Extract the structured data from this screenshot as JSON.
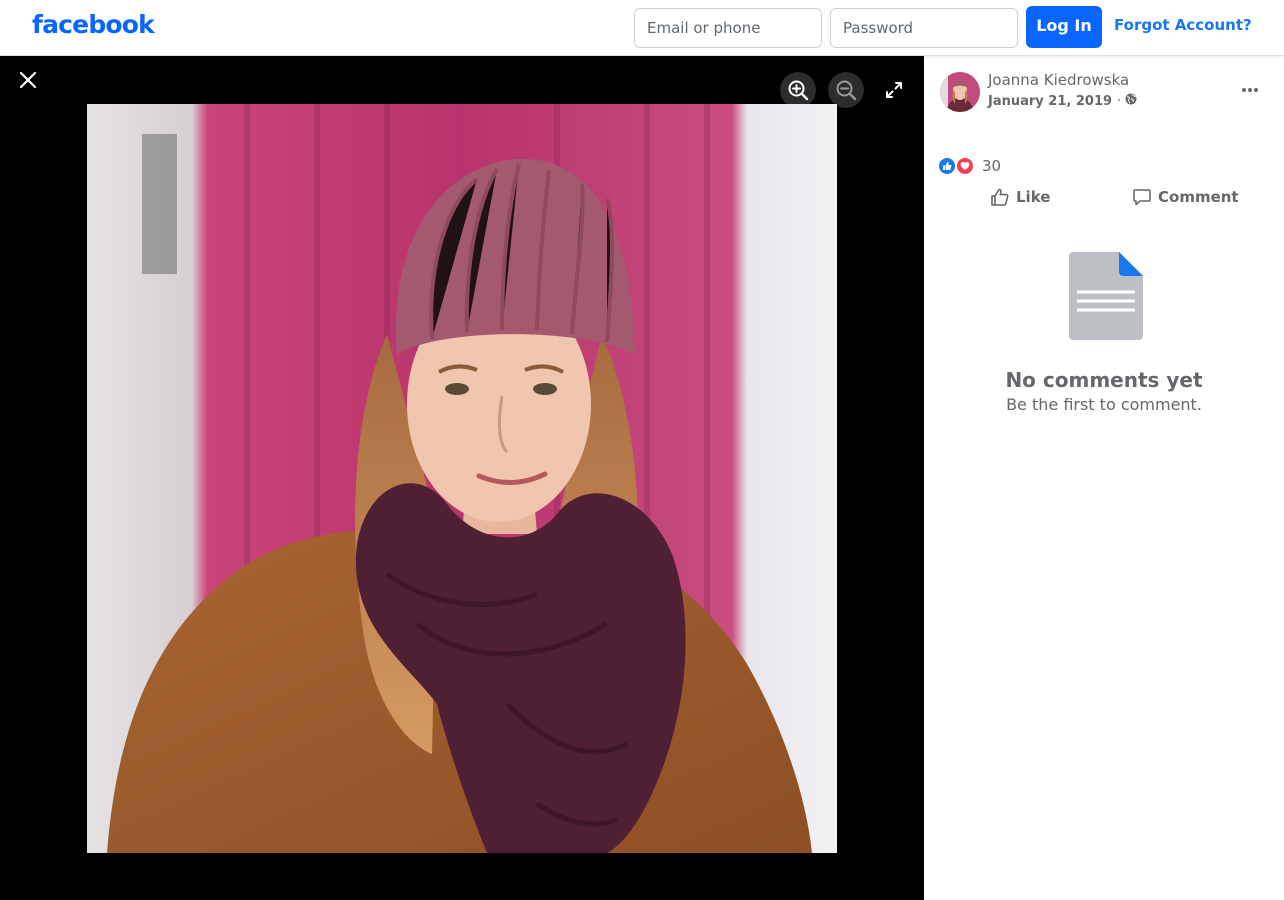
{
  "colors": {
    "brand": "#0866ff",
    "brand_text": "#1877f2",
    "muted": "#65676b",
    "viewer_bg": "#000000",
    "love": "#f33e58"
  },
  "header": {
    "logo_text": "facebook",
    "email_placeholder": "Email or phone",
    "password_placeholder": "Password",
    "login_label": "Log In",
    "forgot_label": "Forgot Account?"
  },
  "viewer": {
    "close_icon": "close-icon",
    "zoom_in_icon": "zoom-in-icon",
    "zoom_out_icon": "zoom-out-icon",
    "fullscreen_icon": "expand-icon",
    "photo_subject": "woman in pink knit beanie and purple scarf"
  },
  "post": {
    "author": "Joanna Kiedrowska",
    "date": "January 21, 2019",
    "separator": "·",
    "audience_icon": "globe-icon",
    "more_icon": "more-horizontal-icon",
    "reactions": {
      "icons": [
        "like-reaction-icon",
        "love-reaction-icon"
      ],
      "count": "30"
    },
    "actions": {
      "like_label": "Like",
      "comment_label": "Comment"
    }
  },
  "comments": {
    "empty_icon": "document-icon",
    "empty_title": "No comments yet",
    "empty_subtitle": "Be the first to comment."
  }
}
